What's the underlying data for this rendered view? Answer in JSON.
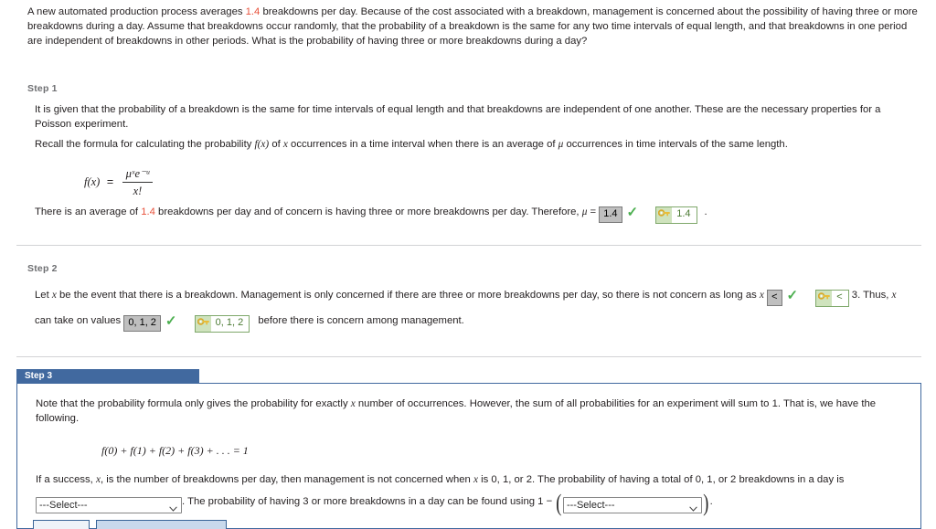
{
  "problem": {
    "text_before_value": "A new automated production process averages ",
    "highlight_value": "1.4",
    "text_after_value": " breakdowns per day. Because of the cost associated with a breakdown, management is concerned about the possibility of having three or more breakdowns during a day. Assume that breakdowns occur randomly, that the probability of a breakdown is the same for any two time intervals of equal length, and that breakdowns in one period are independent of breakdowns in other periods. What is the probability of having three or more breakdowns during a day?"
  },
  "step1": {
    "label": "Step 1",
    "paragraph1": "It is given that the probability of a breakdown is the same for time intervals of equal length and that breakdowns are independent of one another. These are the necessary properties for a Poisson experiment.",
    "paragraph2_a": "Recall the formula for calculating the probability ",
    "paragraph2_fx": "f(x)",
    "paragraph2_b": " of ",
    "paragraph2_x": "x",
    "paragraph2_c": " occurrences in a time interval when there is an average of ",
    "paragraph2_mu": "μ",
    "paragraph2_d": " occurrences in time intervals of the same length.",
    "formula": {
      "lhs": "f(x)",
      "eq": "=",
      "numerator": "μˣe⁻ᵘ",
      "denominator": "x!"
    },
    "answer_line_a": "There is an average of ",
    "answer_line_value": "1.4",
    "answer_line_b": " breakdowns per day and of concern is having three or more breakdowns per day. Therefore, ",
    "answer_line_mu": "μ",
    "answer_line_eq": " = ",
    "answer_input": "1.4",
    "answer_key": "1.4",
    "answer_line_end": "."
  },
  "step2": {
    "label": "Step 2",
    "line1_a": "Let ",
    "line1_x": "x",
    "line1_b": " be the event that there is a breakdown. Management is only concerned if there are three or more breakdowns per day, so there is not concern as long as ",
    "line1_x2": "x",
    "answer_input1": "<",
    "answer_key1": "<",
    "line1_c": " 3. Thus, ",
    "line1_x3": "x",
    "line2_a": "can take on values ",
    "answer_input2": "0, 1, 2",
    "answer_key2": "0, 1, 2",
    "line2_b": " before there is concern among management."
  },
  "step3": {
    "label": "Step 3",
    "paragraph1_a": "Note that the probability formula only gives the probability for exactly ",
    "paragraph1_x": "x",
    "paragraph1_b": " number of occurrences. However, the sum of all probabilities for an experiment will sum to 1. That is, we have the following.",
    "equation": "f(0) + f(1) + f(2) + f(3) + . . . = 1",
    "paragraph2_a": "If a success, ",
    "paragraph2_x": "x",
    "paragraph2_b": ", is the number of breakdowns per day, then management is not concerned when ",
    "paragraph2_x2": "x",
    "paragraph2_c": " is 0, 1, or 2. The probability of having a total of 0, 1, or 2 breakdowns in a day is",
    "select1_value": "---Select---",
    "line3_mid": ". The probability of having 3 or more breakdowns in a day can be found using 1 − ",
    "select2_value": "---Select---",
    "line3_end": "."
  },
  "icons": {
    "check": "check-icon",
    "key": "key-icon",
    "chevron": "chevron-down-icon"
  },
  "colors": {
    "highlight_red": "#e8503a",
    "step_blue": "#41699f",
    "check_green": "#4caf50",
    "key_green": "#4b7a33"
  }
}
